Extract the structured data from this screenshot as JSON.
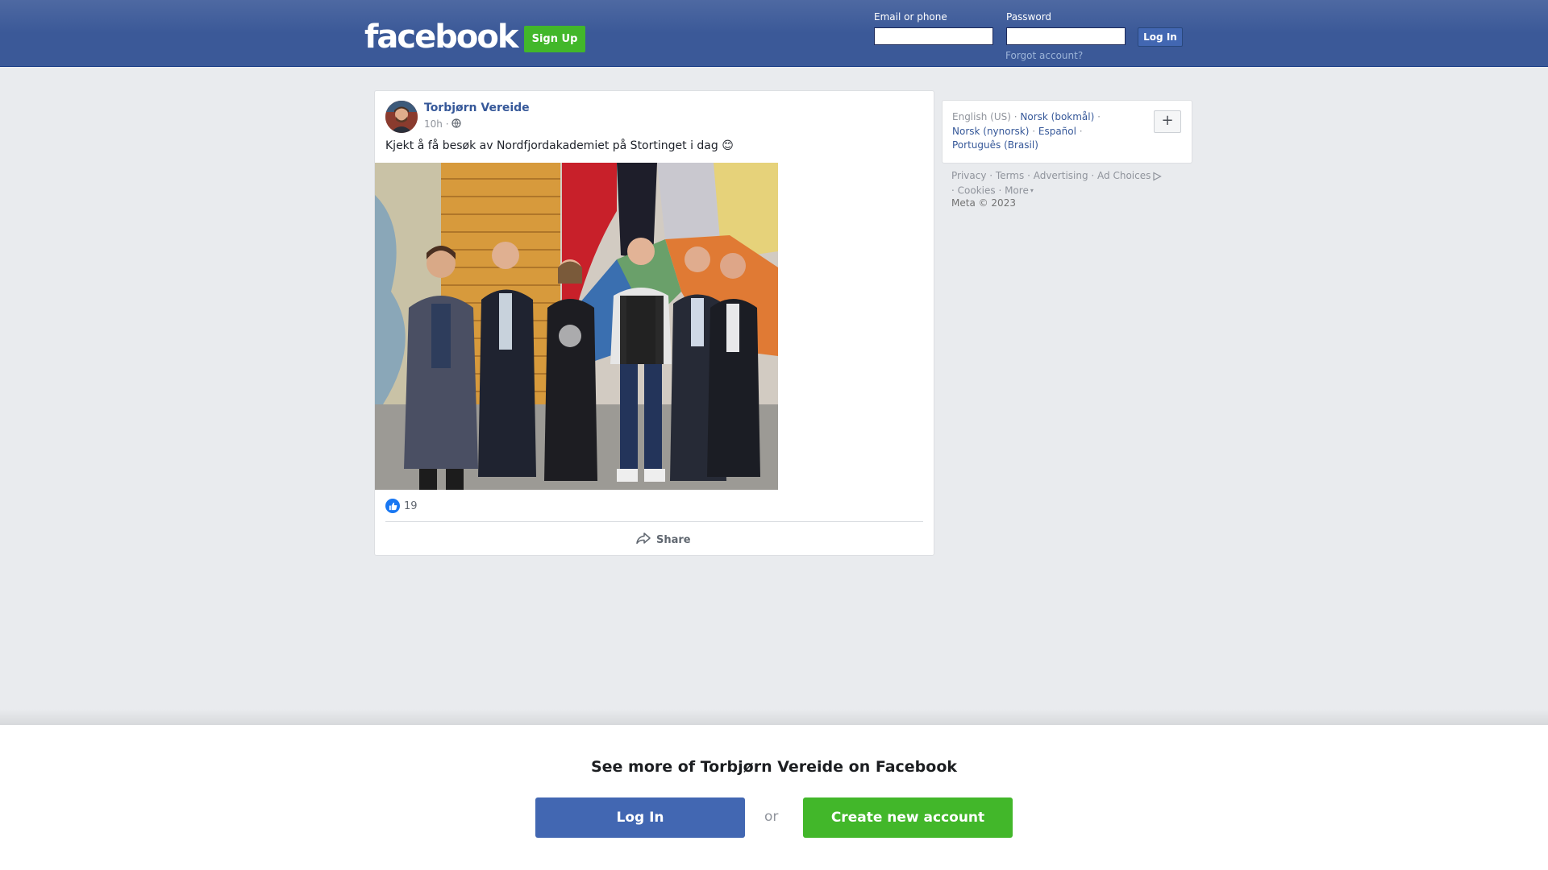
{
  "header": {
    "logo_text": "facebook",
    "signup_label": "Sign Up",
    "email_label": "Email or phone",
    "password_label": "Password",
    "login_label": "Log In",
    "forgot_label": "Forgot account?"
  },
  "post": {
    "author": "Torbjørn Vereide",
    "time": "10h ·",
    "privacy_icon": "globe-icon",
    "text": "Kjekt å få besøk av Nordfjordakademiet på Stortinget i dag 😊",
    "reaction_icon": "like-icon",
    "reaction_count": "19",
    "share_label": "Share",
    "share_icon": "share-icon"
  },
  "sidebar": {
    "current_language": "English (US)",
    "languages": [
      "Norsk (bokmål)",
      "Norsk (nynorsk)",
      "Español",
      "Português (Brasil)"
    ],
    "more_languages_label": "+",
    "footer_links": [
      "Privacy",
      "Terms",
      "Advertising",
      "Ad Choices",
      "Cookies",
      "More"
    ],
    "copyright": "Meta © 2023"
  },
  "bottom": {
    "title": "See more of Torbjørn Vereide on Facebook",
    "login_label": "Log In",
    "or_label": "or",
    "create_label": "Create new account"
  },
  "colors": {
    "brand_blue": "#3b5998",
    "button_blue": "#4267b2",
    "green": "#42b72a",
    "link": "#365899"
  }
}
